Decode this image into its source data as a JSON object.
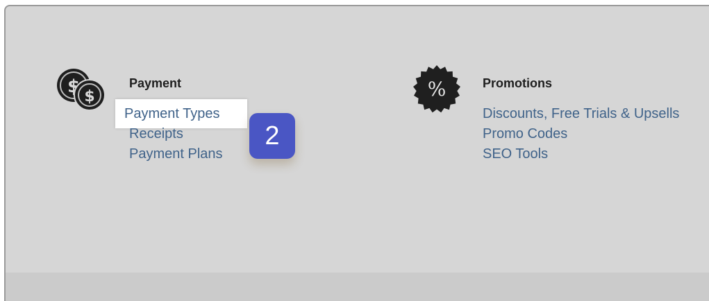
{
  "payment": {
    "icon": "coins-dollar-icon",
    "title": "Payment",
    "links": [
      "Payment Types",
      "Receipts",
      "Payment Plans"
    ]
  },
  "promotions": {
    "icon": "percent-seal-icon",
    "title": "Promotions",
    "links": [
      "Discounts, Free Trials & Upsells",
      "Promo Codes",
      "SEO Tools"
    ]
  },
  "step_badge": {
    "label": "2",
    "color": "#4a56c4"
  },
  "colors": {
    "panel_bg": "#d6d6d6",
    "link": "#3f6289",
    "title": "#1e1e1e"
  }
}
